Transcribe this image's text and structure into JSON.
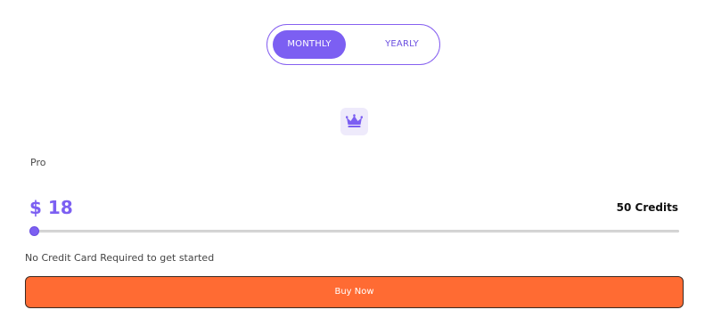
{
  "billing_toggle": {
    "options": [
      {
        "label": "MONTHLY",
        "selected": true
      },
      {
        "label": "YEARLY",
        "selected": false
      }
    ]
  },
  "plan": {
    "icon": "crown-icon",
    "name": "Pro",
    "currency": "$",
    "price": "18",
    "credits": "50 Credits"
  },
  "slider": {
    "value_fraction": 0.0
  },
  "note": "No Credit Card Required to get started",
  "cta": {
    "label": "Buy Now"
  },
  "colors": {
    "accent": "#7c5ff2",
    "cta": "#ff6b33",
    "icon_bg": "#eeeafb"
  }
}
